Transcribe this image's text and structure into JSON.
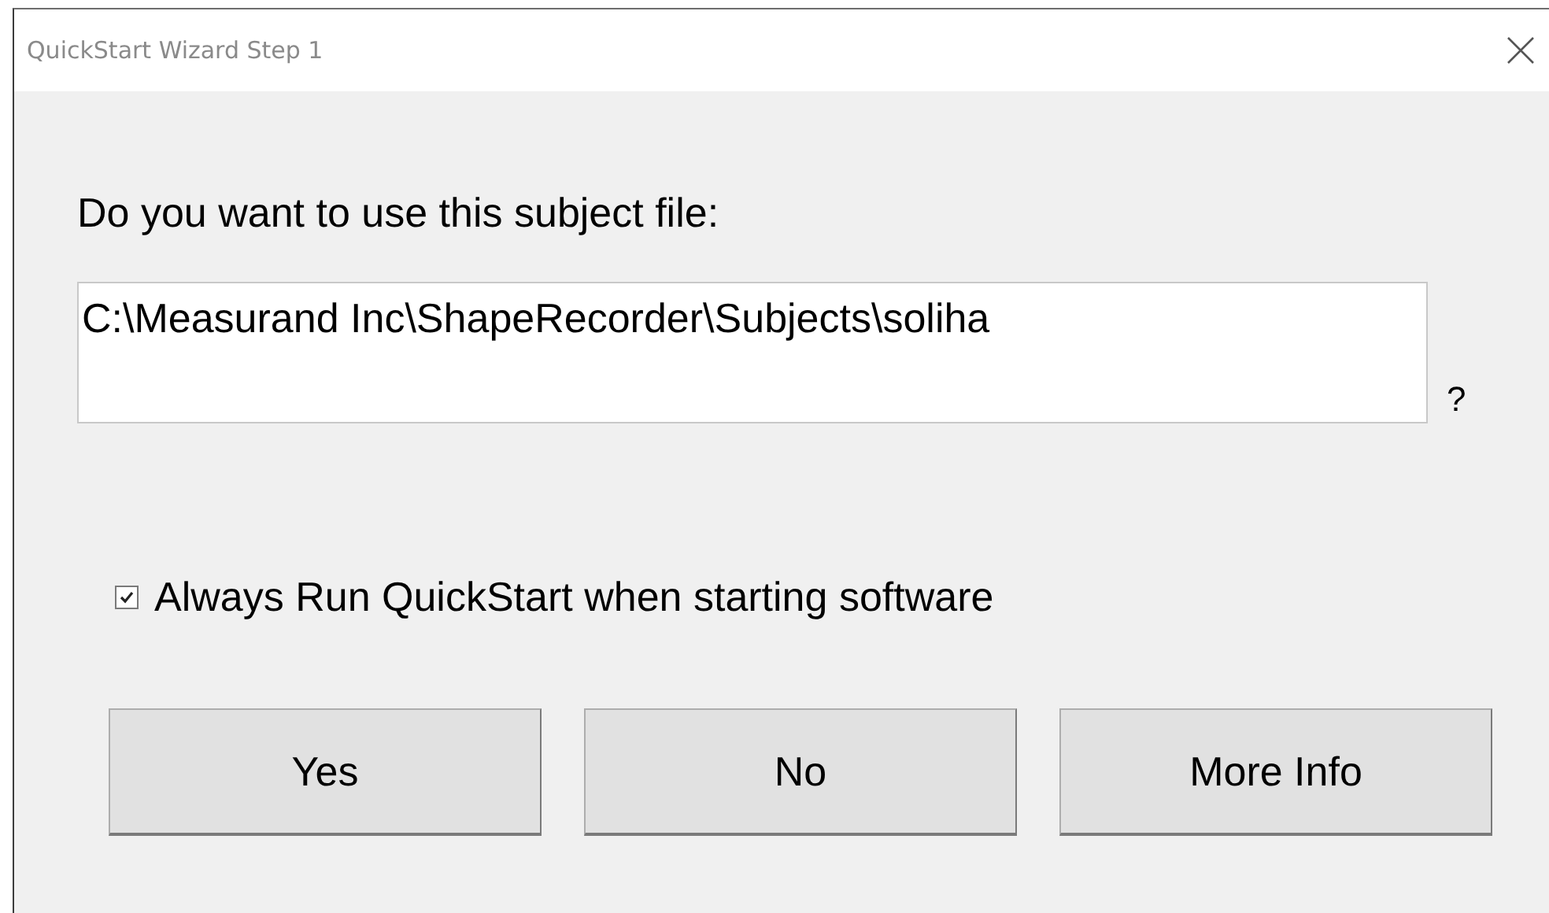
{
  "window": {
    "title": "QuickStart Wizard Step 1"
  },
  "prompt": "Do you want to use this subject file:",
  "file_field": {
    "value": "C:\\Measurand Inc\\ShapeRecorder\\Subjects\\soliha"
  },
  "help_mark": "?",
  "always_run": {
    "label": "Always Run QuickStart when starting software",
    "checked": true
  },
  "buttons": [
    "Yes",
    "No",
    "More Info"
  ]
}
